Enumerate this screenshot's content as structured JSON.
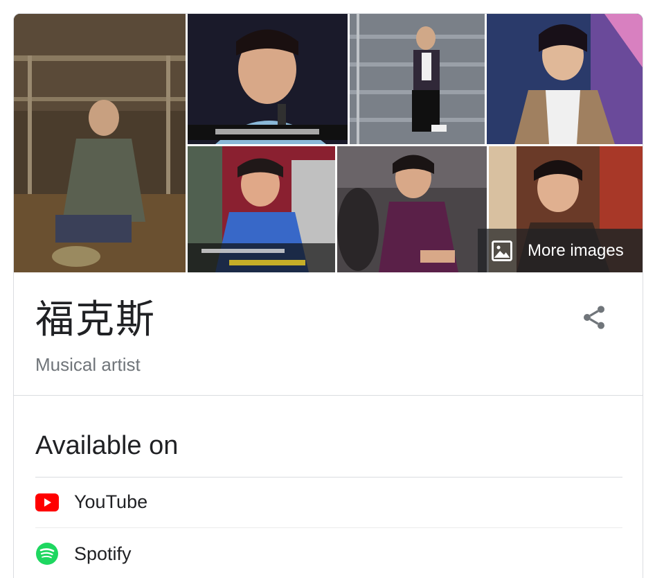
{
  "entity": {
    "title": "福克斯",
    "subtitle": "Musical artist"
  },
  "gallery": {
    "more_images_label": "More images",
    "images": [
      {
        "subject": "artist-sitting-under-shelter"
      },
      {
        "subject": "artist-singing-with-microphone"
      },
      {
        "subject": "artist-sitting-on-stairs"
      },
      {
        "subject": "artist-wearing-patterned-jacket"
      },
      {
        "subject": "artist-in-blue-jacket"
      },
      {
        "subject": "artist-in-purple-shirt"
      },
      {
        "subject": "artist-street-portrait"
      }
    ]
  },
  "available_on": {
    "heading": "Available on",
    "providers": [
      {
        "name": "YouTube",
        "icon": "youtube-icon",
        "color": "#ff0000"
      },
      {
        "name": "Spotify",
        "icon": "spotify-icon",
        "color": "#1ed760"
      }
    ]
  },
  "colors": {
    "text_primary": "#202124",
    "text_secondary": "#70757a",
    "divider": "#dadce0"
  }
}
